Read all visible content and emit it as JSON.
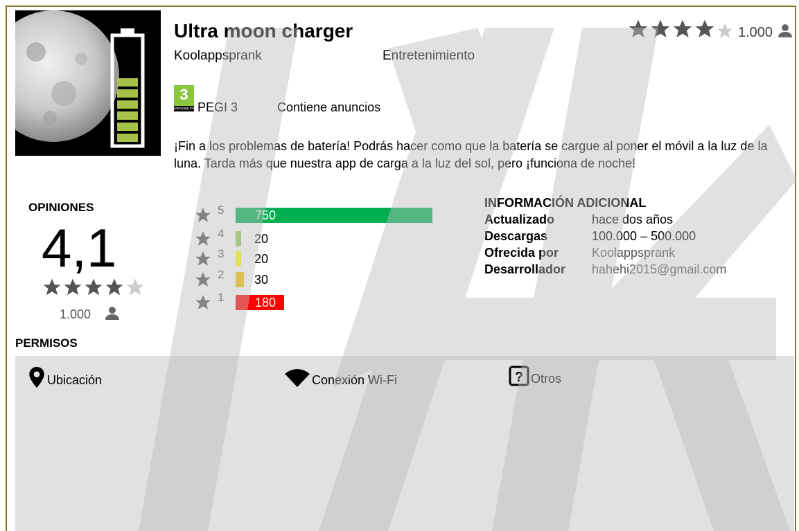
{
  "app": {
    "title": "Ultra moon charger",
    "developer": "Koolappsprank",
    "category": "Entretenimiento",
    "pegi_number": "3",
    "pegi_site": "www.pegi.info",
    "pegi_label": "PEGI 3",
    "ads_label": "Contiene anuncios",
    "description": "¡Fin a los problemas de batería! Podrás hacer como que la batería se cargue al poner el móvil a la luz de la luna. Tarda más que nuestra app de carga a la luz del sol, pero ¡funciona de noche!"
  },
  "top_rating": {
    "stars_filled": 4,
    "count": "1.000",
    "icon": "user-icon"
  },
  "reviews": {
    "title": "OPINIONES",
    "score": "4,1",
    "stars_filled": 4,
    "count": "1.000",
    "histogram": [
      {
        "stars": "5",
        "value": "750",
        "color": "#00b050"
      },
      {
        "stars": "4",
        "value": "20",
        "color": "#92d050"
      },
      {
        "stars": "3",
        "value": "20",
        "color": "#ffff00"
      },
      {
        "stars": "2",
        "value": "30",
        "color": "#ffc000"
      },
      {
        "stars": "1",
        "value": "180",
        "color": "#ff0000"
      }
    ]
  },
  "info": {
    "title": "INFORMACIÓN ADICIONAL",
    "rows": [
      {
        "key": "Actualizado",
        "value": "hace dos  años"
      },
      {
        "key": "Descargas",
        "value": "100.000 – 500.000"
      },
      {
        "key": "Ofrecida por",
        "value": "Koolappsprank"
      },
      {
        "key": "Desarrollador",
        "value": "hahehi2015@gmail.com"
      }
    ]
  },
  "permissions": {
    "title": "PERMISOS",
    "items": [
      {
        "label": "Ubicación",
        "icon": "location-pin-icon"
      },
      {
        "label": "Conexión Wi-Fi",
        "icon": "wifi-icon"
      },
      {
        "label": "Otros",
        "icon": "question-box-icon"
      }
    ]
  },
  "colors": {
    "border": "#8c6d2c",
    "panel": "#e1e1e1",
    "star": "#555555",
    "star_empty": "#cccccc"
  }
}
